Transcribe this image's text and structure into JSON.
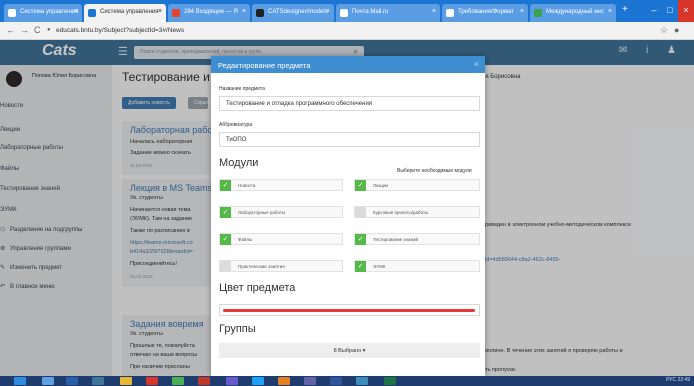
{
  "browser": {
    "tabs": [
      {
        "label": "Система управления"
      },
      {
        "label": "Система управления"
      },
      {
        "label": "284 Входящие — Я"
      },
      {
        "label": "CATSdesigner/models"
      },
      {
        "label": "Почта Mail.ru"
      },
      {
        "label": "Требования/Формат"
      },
      {
        "label": "Международный инс"
      }
    ],
    "new_tab": "+",
    "url": "educats.bntu.by/Subject?subjectId=3#/News",
    "nav": {
      "back": "←",
      "forward": "→",
      "reload": "C"
    }
  },
  "app": {
    "logo": "Cats",
    "search_placeholder": "Поиск студентов, преподавателей, проектов и групп",
    "topright_icons": "✉ i ♟"
  },
  "sidebar": {
    "user_name": "Попова Юлия Борисовна",
    "items": [
      {
        "label": "Новости",
        "icon": ""
      },
      {
        "label": "Лекции",
        "icon": ""
      },
      {
        "label": "Лабораторные работы",
        "icon": ""
      },
      {
        "label": "Файлы",
        "icon": ""
      },
      {
        "label": "Тестирование знаний",
        "icon": ""
      },
      {
        "label": "ЭУМК",
        "icon": ""
      },
      {
        "label": "Разделение на подгруппы",
        "icon": "group-icon"
      },
      {
        "label": "Управление группами",
        "icon": "settings-icon"
      },
      {
        "label": "Изменить предмет",
        "icon": "edit-icon"
      },
      {
        "label": "В главное меню",
        "icon": "back-icon"
      }
    ]
  },
  "main": {
    "title": "Тестирование и с",
    "teacher": "ия Борисовна",
    "buttons": {
      "add_news": "Добавить новость",
      "second": "Скрыть"
    },
    "cards": [
      {
        "title": "Лабораторная рабо",
        "lines": [
          "Началась лабораторная",
          "Задание можно скачать"
        ],
        "date": "11.03.2020"
      },
      {
        "title": "Лекция в MS Teams",
        "lines": [
          "Ув. студенты",
          "Начинается новая тема",
          "(ЭУМК). Там на задание",
          "Также по расписанию в"
        ],
        "link": "https://teams.microsoft.co",
        "link2": "b414a3/25f7528tenantId=",
        "extra": "Присоединяйтесь!",
        "date": "04.03.2020"
      },
      {
        "title": "Задания вовремя",
        "lines": [
          "Ув. студенты",
          "Прошлые те, пожалуйста",
          "отвечаю на ваши вопросы",
          "При наличии присланы"
        ]
      }
    ],
    "right_snippets": [
      "приведен в электронном учебно-методическом комплексе",
      "uid=4d589644-c8a2-462c-8455-",
      "циплине. В течение этих занятий я проверяю работы и",
      "ять пропуски."
    ]
  },
  "modal": {
    "title": "Редактирование предмета",
    "close": "×",
    "subject_label": "Название предмета",
    "subject_value": "Тестирование и отладка программного обеспечения",
    "abbr_label": "Аббревиатура",
    "abbr_value": "ТиОПО",
    "modules_heading": "Модули",
    "modules_hint": "Выберите необходимые модули",
    "modules": [
      {
        "label": "Новости",
        "checked": true
      },
      {
        "label": "Лекции",
        "checked": true
      },
      {
        "label": "Лабораторные работы",
        "checked": true
      },
      {
        "label": "Курсовые проекты/работы",
        "checked": false
      },
      {
        "label": "Файлы",
        "checked": true
      },
      {
        "label": "Тестирование знаний",
        "checked": true
      },
      {
        "label": "Практические занятия",
        "checked": false
      },
      {
        "label": "ЭУМК",
        "checked": true
      }
    ],
    "color_heading": "Цвет предмета",
    "color_value": "#e03a3a",
    "groups_heading": "Группы",
    "groups_selected": "8 Выбрано ▾"
  },
  "taskbar": {
    "clock": "22:49",
    "lang": "РУС"
  },
  "colors": {
    "tabbar": "#1c74d3",
    "topnav": "#3f7397",
    "modal_header": "#3e8dd0",
    "check_on": "#54b948",
    "taskbar": "#1e3d6e"
  }
}
